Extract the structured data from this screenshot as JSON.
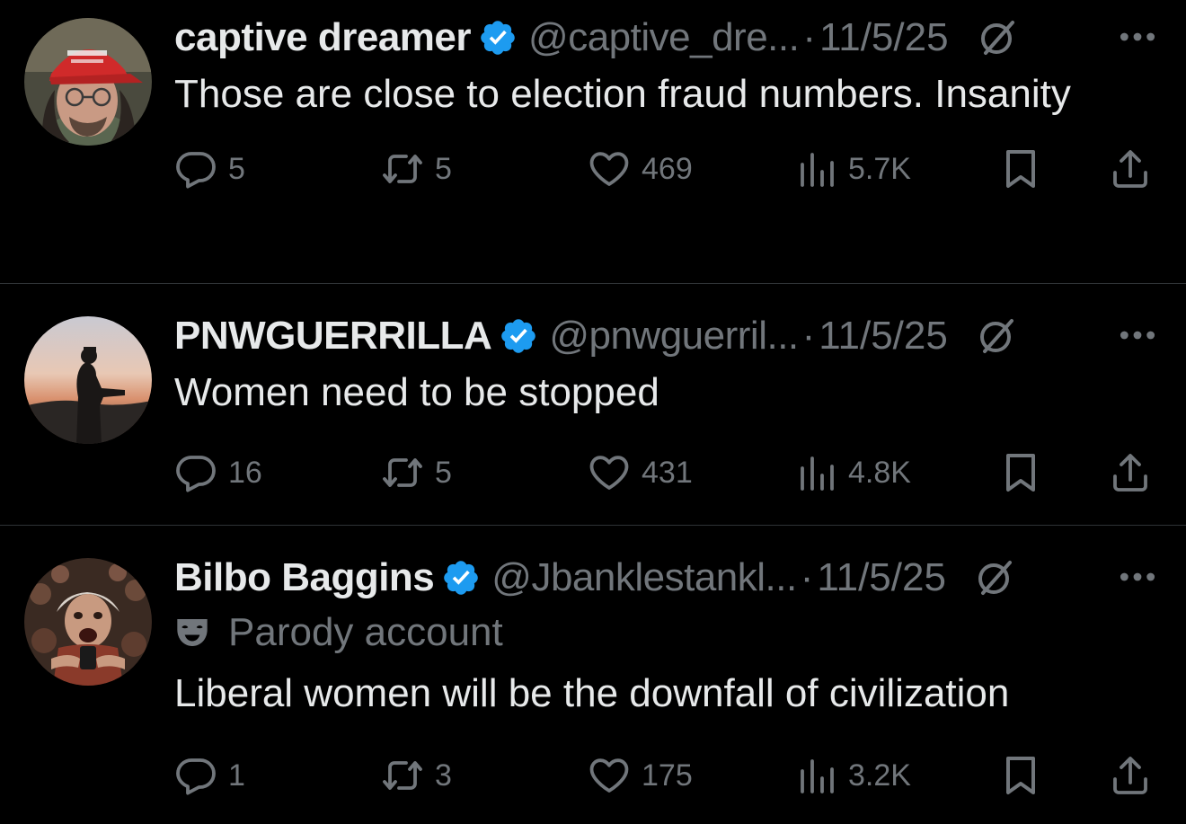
{
  "colors": {
    "background": "#000000",
    "text_primary": "#e7e9ea",
    "text_secondary": "#71767b",
    "verified_blue": "#1d9bf0",
    "divider": "#2f3336"
  },
  "tweets": [
    {
      "display_name": "captive dreamer",
      "handle": "@captive_dre...",
      "dot": "·",
      "date": "11/5/25",
      "verified": true,
      "parody_label": "",
      "text": "Those are close to election fraud numbers. Insanity",
      "metrics": {
        "replies": "5",
        "reposts": "5",
        "likes": "469",
        "views": "5.7K"
      },
      "avatar_icon": "avatar-red-cap-man"
    },
    {
      "display_name": "PNWGUERRILLA",
      "handle": "@pnwguerril...",
      "dot": "·",
      "date": "11/5/25",
      "verified": true,
      "parody_label": "",
      "text": "Women need to be stopped",
      "metrics": {
        "replies": "16",
        "reposts": "5",
        "likes": "431",
        "views": "4.8K"
      },
      "avatar_icon": "avatar-soldier-silhouette"
    },
    {
      "display_name": "Bilbo Baggins",
      "handle": "@Jbanklestankl...",
      "dot": "·",
      "date": "11/5/25",
      "verified": true,
      "parody_label": "Parody account",
      "text": "Liberal women will be the downfall of civilization",
      "metrics": {
        "replies": "1",
        "reposts": "3",
        "likes": "175",
        "views": "3.2K"
      },
      "avatar_icon": "avatar-bilbo"
    }
  ],
  "icons": {
    "reply": "reply-icon",
    "repost": "repost-icon",
    "like": "heart-icon",
    "views": "views-icon",
    "bookmark": "bookmark-icon",
    "share": "share-icon",
    "grok": "grok-icon",
    "more": "more-icon",
    "verified": "verified-badge-icon",
    "parody": "theater-mask-icon"
  }
}
